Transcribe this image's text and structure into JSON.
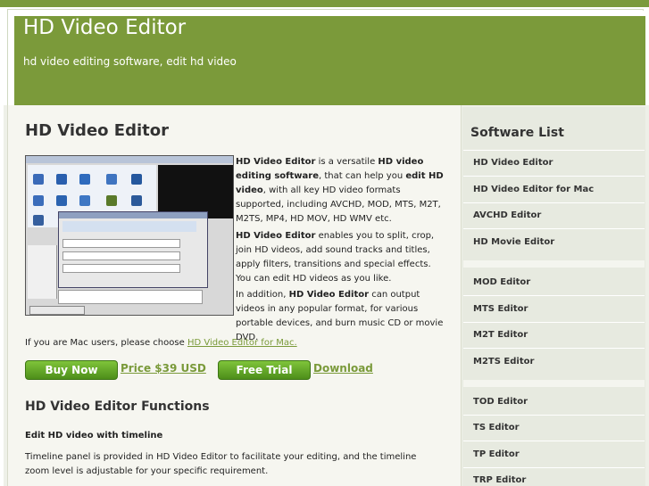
{
  "site": {
    "title": "HD Video Editor",
    "tagline": "hd video editing software, edit hd video"
  },
  "main": {
    "title": "HD Video Editor",
    "screenshot_alt": "HD Video Editor screenshot",
    "intro_1_lead": "HD Video Editor",
    "intro_1_text_a": " is a versatile ",
    "intro_1_bold_b": "HD video editing software",
    "intro_1_text_c": ", that can help you ",
    "intro_1_bold_d": "edit HD video",
    "intro_1_text_e": ", with all key HD video formats supported, including AVCHD, MOD, MTS, M2T, M2TS, MP4, HD MOV, HD WMV etc.",
    "intro_2_lead": "HD Video Editor",
    "intro_2_text": " enables you to split, crop, join HD videos, add sound tracks and titles, apply filters, transitions and special effects. You can edit HD videos as you like.",
    "intro_3_a": "In addition, ",
    "intro_3_bold": "HD Video Editor",
    "intro_3_b": " can output videos in any popular format, for various portable devices, and burn music CD or movie DVD.",
    "mac_text": "If you are Mac users, please choose ",
    "mac_link": "HD Video Editor for Mac.",
    "buy_now": "Buy Now",
    "price": "Price $39 USD",
    "free_trial": "Free Trial",
    "download": "Download",
    "functions_title": "HD Video Editor Functions",
    "func_1_title": "Edit HD video with timeline",
    "func_1_text": "Timeline panel is provided in HD Video Editor to facilitate your editing, and the timeline zoom level is adjustable for your specific requirement."
  },
  "sidebar": {
    "title": "Software List",
    "items": [
      "HD Video Editor",
      "HD Video Editor for Mac",
      "AVCHD Editor",
      "HD Movie Editor",
      "MOD Editor",
      "MTS Editor",
      "M2T Editor",
      "M2TS Editor",
      "TOD Editor",
      "TS Editor",
      "TP Editor",
      "TRP Editor"
    ]
  },
  "colors": {
    "header_green": "#7b9a3a",
    "button_green": "#5aa022",
    "link_green": "#7a9a3a"
  }
}
